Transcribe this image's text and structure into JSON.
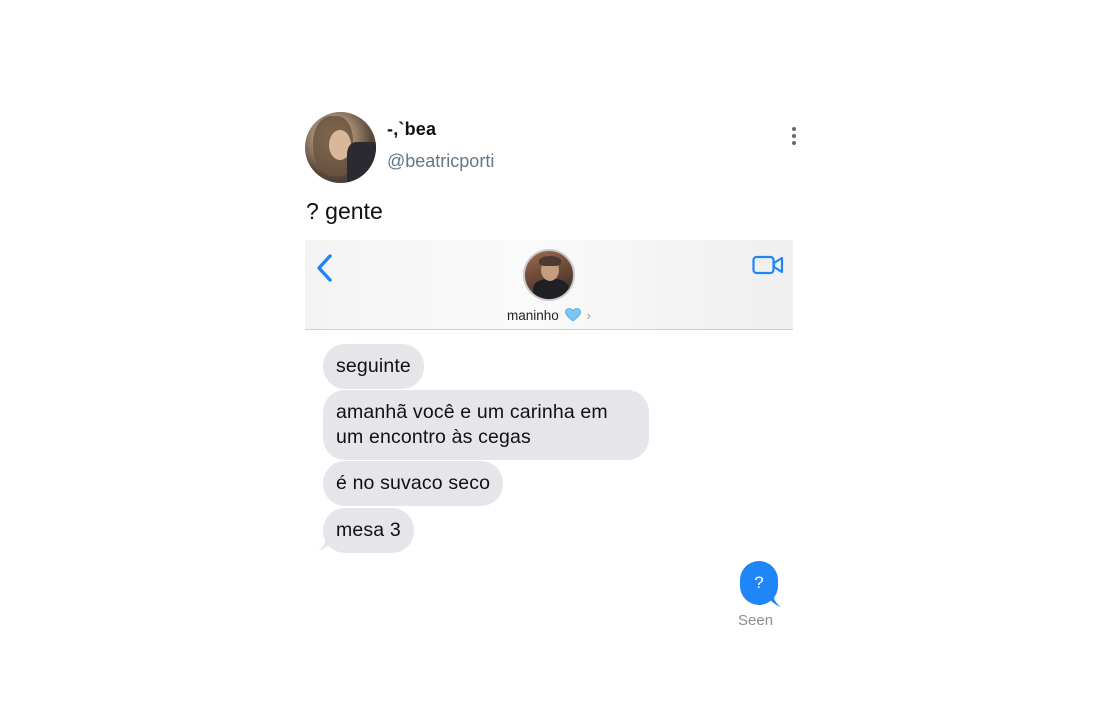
{
  "tweet": {
    "display_name": "-,`bea",
    "handle": "@beatricporti",
    "text": "? gente",
    "more_icon": "more-vertical-icon"
  },
  "screenshot": {
    "contact_name": "maninho",
    "contact_emoji": "blue-heart",
    "chevron": "›",
    "accent_color": "#1e86f7",
    "received_bubble_color": "#e5e5ea",
    "messages_received": [
      "seguinte",
      "amanhã você e um carinha em um encontro às cegas",
      "é no suvaco seco",
      "mesa 3"
    ],
    "message_sent": "?",
    "status": "Seen"
  }
}
